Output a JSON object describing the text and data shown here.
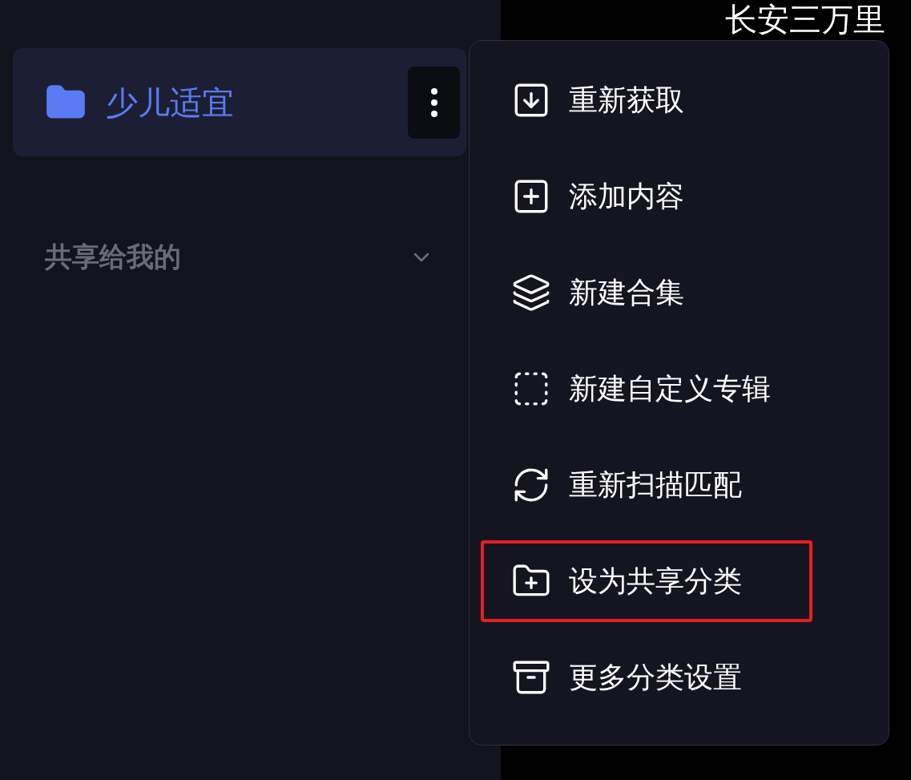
{
  "header": {
    "title": "长安三万里"
  },
  "sidebar": {
    "items": [
      {
        "label": "少儿适宜",
        "selected": true
      }
    ],
    "sections": [
      {
        "label": "共享给我的",
        "expanded": false
      }
    ]
  },
  "context_menu": {
    "items": [
      {
        "label": "重新获取",
        "highlighted": false
      },
      {
        "label": "添加内容",
        "highlighted": false
      },
      {
        "label": "新建合集",
        "highlighted": false
      },
      {
        "label": "新建自定义专辑",
        "highlighted": false
      },
      {
        "label": "重新扫描匹配",
        "highlighted": false
      },
      {
        "label": "设为共享分类",
        "highlighted": true
      },
      {
        "label": "更多分类设置",
        "highlighted": false
      }
    ]
  }
}
